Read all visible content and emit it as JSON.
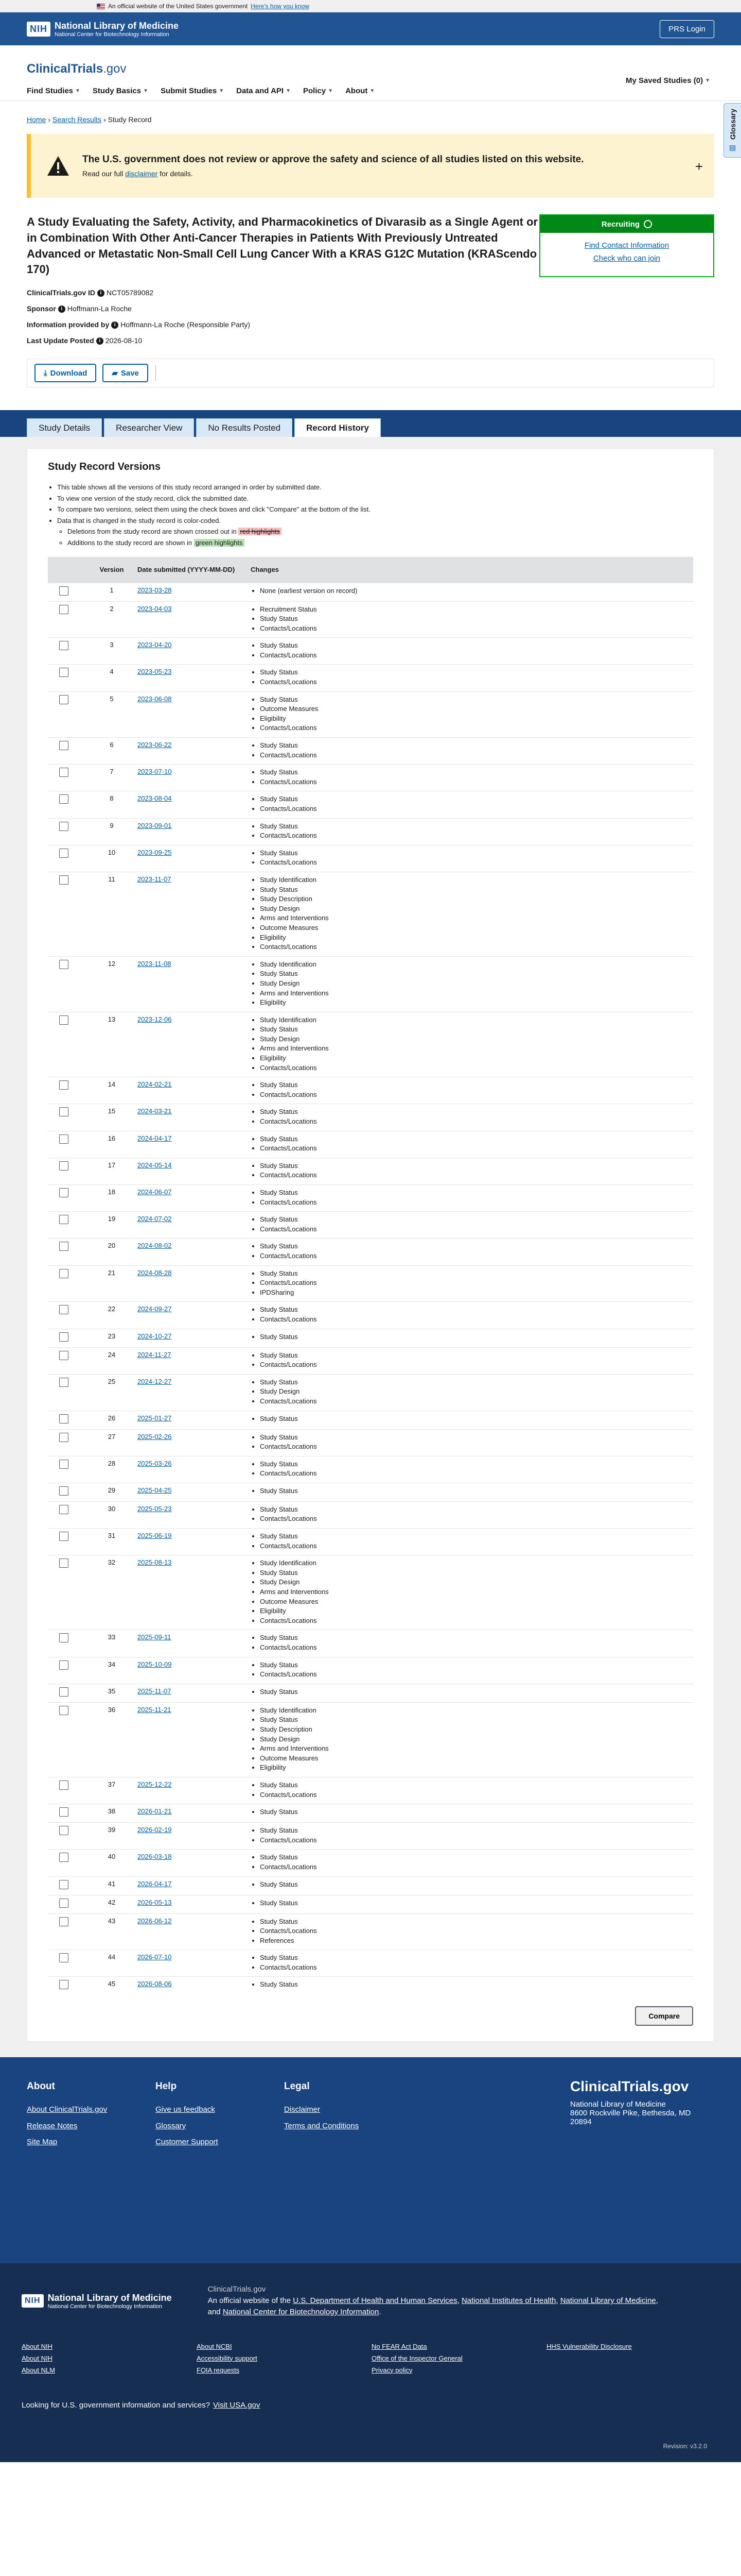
{
  "gov_banner": {
    "text": "An official website of the United States government",
    "link": "Here's how you know"
  },
  "nlm": {
    "nih": "NIH",
    "title": "National Library of Medicine",
    "subtitle": "National Center for Biotechnology Information",
    "prs_button": "PRS Login"
  },
  "header": {
    "brand": "ClinicalTrials",
    "brand_suffix": ".gov",
    "nav": [
      "Find Studies",
      "Study Basics",
      "Submit Studies",
      "Data and API",
      "Policy",
      "About"
    ],
    "saved": "My Saved Studies (0)",
    "glossary": "Glossary"
  },
  "breadcrumb": [
    "Home",
    "Search Results",
    "Study Record"
  ],
  "alert": {
    "title": "The U.S. government does not review or approve the safety and science of all studies listed on this website.",
    "body_prefix": "Read our full",
    "body_link": "disclaimer",
    "body_suffix": "for details."
  },
  "study": {
    "title": "A Study Evaluating the Safety, Activity, and Pharmacokinetics of Divarasib as a Single Agent or in Combination With Other Anti-Cancer Therapies in Patients With Previously Untreated Advanced or Metastatic Non-Small Cell Lung Cancer With a KRAS G12C Mutation (KRAScendo 170)",
    "id_label": "ClinicalTrials.gov ID",
    "id": "NCT05789082",
    "sponsor_label": "Sponsor",
    "sponsor": "Hoffmann-La Roche",
    "info_label": "Information provided by",
    "info": "Hoffmann-La Roche (Responsible Party)",
    "update_label": "Last Update Posted",
    "update": "2026-08-10"
  },
  "status_card": {
    "status": "Recruiting",
    "link1": "Find Contact Information",
    "link2": "Check who can join"
  },
  "actions": {
    "download": "Download",
    "save": "Save"
  },
  "tabs": [
    "Study Details",
    "Researcher View",
    "No Results Posted",
    "Record History"
  ],
  "versions": {
    "heading": "Study Record Versions",
    "notes": {
      "n1": "This table shows all the versions of this study record arranged in order by submitted date.",
      "n2": "To view one version of the study record, click the submitted date.",
      "n3": "To compare two versions, select them using the check boxes and click \"Compare\" at the bottom of the list.",
      "n4": "Data that is changed in the study record is color-coded.",
      "n5a": "Deletions from the study record are shown crossed out in",
      "n5b": "red highlights",
      "n6a": "Additions to the study record are shown in",
      "n6b": "green highlights"
    },
    "columns": [
      "Version",
      "Date submitted (YYYY-MM-DD)",
      "Changes"
    ],
    "rows": [
      {
        "v": "1",
        "d": "2023-03-28",
        "c": [
          "None (earliest version on record)"
        ]
      },
      {
        "v": "2",
        "d": "2023-04-03",
        "c": [
          "Recruitment Status",
          "Study Status",
          "Contacts/Locations"
        ]
      },
      {
        "v": "3",
        "d": "2023-04-20",
        "c": [
          "Study Status",
          "Contacts/Locations"
        ]
      },
      {
        "v": "4",
        "d": "2023-05-23",
        "c": [
          "Study Status",
          "Contacts/Locations"
        ]
      },
      {
        "v": "5",
        "d": "2023-06-08",
        "c": [
          "Study Status",
          "Outcome Measures",
          "Eligibility",
          "Contacts/Locations"
        ]
      },
      {
        "v": "6",
        "d": "2023-06-22",
        "c": [
          "Study Status",
          "Contacts/Locations"
        ]
      },
      {
        "v": "7",
        "d": "2023-07-10",
        "c": [
          "Study Status",
          "Contacts/Locations"
        ]
      },
      {
        "v": "8",
        "d": "2023-08-04",
        "c": [
          "Study Status",
          "Contacts/Locations"
        ]
      },
      {
        "v": "9",
        "d": "2023-09-01",
        "c": [
          "Study Status",
          "Contacts/Locations"
        ]
      },
      {
        "v": "10",
        "d": "2023-09-25",
        "c": [
          "Study Status",
          "Contacts/Locations"
        ]
      },
      {
        "v": "11",
        "d": "2023-11-07",
        "c": [
          "Study Identification",
          "Study Status",
          "Study Description",
          "Study Design",
          "Arms and Interventions",
          "Outcome Measures",
          "Eligibility",
          "Contacts/Locations"
        ]
      },
      {
        "v": "12",
        "d": "2023-11-08",
        "c": [
          "Study Identification",
          "Study Status",
          "Study Design",
          "Arms and Interventions",
          "Eligibility"
        ]
      },
      {
        "v": "13",
        "d": "2023-12-06",
        "c": [
          "Study Identification",
          "Study Status",
          "Study Design",
          "Arms and Interventions",
          "Eligibility",
          "Contacts/Locations"
        ]
      },
      {
        "v": "14",
        "d": "2024-02-21",
        "c": [
          "Study Status",
          "Contacts/Locations"
        ]
      },
      {
        "v": "15",
        "d": "2024-03-21",
        "c": [
          "Study Status",
          "Contacts/Locations"
        ]
      },
      {
        "v": "16",
        "d": "2024-04-17",
        "c": [
          "Study Status",
          "Contacts/Locations"
        ]
      },
      {
        "v": "17",
        "d": "2024-05-14",
        "c": [
          "Study Status",
          "Contacts/Locations"
        ]
      },
      {
        "v": "18",
        "d": "2024-06-07",
        "c": [
          "Study Status",
          "Contacts/Locations"
        ]
      },
      {
        "v": "19",
        "d": "2024-07-02",
        "c": [
          "Study Status",
          "Contacts/Locations"
        ]
      },
      {
        "v": "20",
        "d": "2024-08-02",
        "c": [
          "Study Status",
          "Contacts/Locations"
        ]
      },
      {
        "v": "21",
        "d": "2024-08-28",
        "c": [
          "Study Status",
          "Contacts/Locations",
          "IPDSharing"
        ]
      },
      {
        "v": "22",
        "d": "2024-09-27",
        "c": [
          "Study Status",
          "Contacts/Locations"
        ]
      },
      {
        "v": "23",
        "d": "2024-10-27",
        "c": [
          "Study Status"
        ]
      },
      {
        "v": "24",
        "d": "2024-11-27",
        "c": [
          "Study Status",
          "Contacts/Locations"
        ]
      },
      {
        "v": "25",
        "d": "2024-12-27",
        "c": [
          "Study Status",
          "Study Design",
          "Contacts/Locations"
        ]
      },
      {
        "v": "26",
        "d": "2025-01-27",
        "c": [
          "Study Status"
        ]
      },
      {
        "v": "27",
        "d": "2025-02-26",
        "c": [
          "Study Status",
          "Contacts/Locations"
        ]
      },
      {
        "v": "28",
        "d": "2025-03-26",
        "c": [
          "Study Status",
          "Contacts/Locations"
        ]
      },
      {
        "v": "29",
        "d": "2025-04-25",
        "c": [
          "Study Status"
        ]
      },
      {
        "v": "30",
        "d": "2025-05-23",
        "c": [
          "Study Status",
          "Contacts/Locations"
        ]
      },
      {
        "v": "31",
        "d": "2025-06-19",
        "c": [
          "Study Status",
          "Contacts/Locations"
        ]
      },
      {
        "v": "32",
        "d": "2025-08-13",
        "c": [
          "Study Identification",
          "Study Status",
          "Study Design",
          "Arms and Interventions",
          "Outcome Measures",
          "Eligibility",
          "Contacts/Locations"
        ]
      },
      {
        "v": "33",
        "d": "2025-09-11",
        "c": [
          "Study Status",
          "Contacts/Locations"
        ]
      },
      {
        "v": "34",
        "d": "2025-10-09",
        "c": [
          "Study Status",
          "Contacts/Locations"
        ]
      },
      {
        "v": "35",
        "d": "2025-11-07",
        "c": [
          "Study Status"
        ]
      },
      {
        "v": "36",
        "d": "2025-11-21",
        "c": [
          "Study Identification",
          "Study Status",
          "Study Description",
          "Study Design",
          "Arms and Interventions",
          "Outcome Measures",
          "Eligibility"
        ]
      },
      {
        "v": "37",
        "d": "2025-12-22",
        "c": [
          "Study Status",
          "Contacts/Locations"
        ]
      },
      {
        "v": "38",
        "d": "2026-01-21",
        "c": [
          "Study Status"
        ]
      },
      {
        "v": "39",
        "d": "2026-02-19",
        "c": [
          "Study Status",
          "Contacts/Locations"
        ]
      },
      {
        "v": "40",
        "d": "2026-03-18",
        "c": [
          "Study Status",
          "Contacts/Locations"
        ]
      },
      {
        "v": "41",
        "d": "2026-04-17",
        "c": [
          "Study Status"
        ]
      },
      {
        "v": "42",
        "d": "2026-05-13",
        "c": [
          "Study Status"
        ]
      },
      {
        "v": "43",
        "d": "2026-06-12",
        "c": [
          "Study Status",
          "Contacts/Locations",
          "References"
        ]
      },
      {
        "v": "44",
        "d": "2026-07-10",
        "c": [
          "Study Status",
          "Contacts/Locations"
        ]
      },
      {
        "v": "45",
        "d": "2026-08-06",
        "c": [
          "Study Status"
        ]
      }
    ],
    "compare": "Compare"
  },
  "footer": {
    "about_title": "About",
    "about_links": [
      "About ClinicalTrials.gov",
      "Release Notes",
      "Site Map"
    ],
    "help_title": "Help",
    "help_links": [
      "Give us feedback",
      "Glossary",
      "Customer Support"
    ],
    "legal_title": "Legal",
    "legal_links": [
      "Disclaimer",
      "Terms and Conditions"
    ],
    "org": "ClinicalTrials.gov",
    "addr1": "National Library of Medicine",
    "addr2": "8600 Rockville Pike, Bethesda, MD",
    "addr3": "20894"
  },
  "footer2": {
    "nih": "NIH",
    "nlm_title": "National Library of Medicine",
    "nlm_sub": "National Center for Biotechnology Information",
    "gov_title": "ClinicalTrials.gov",
    "gov_prefix": "An official website of the",
    "hhs": "U.S. Department of Health and Human Services",
    "nih_link": "National Institutes of Health",
    "nlm_link": "National Library of Medicine",
    "and": "and",
    "ncbi": "National Center for Biotechnology Information",
    "links": [
      "About NIH",
      "About NCBI",
      "No FEAR Act Data",
      "HHS Vulnerability Disclosure",
      "About NIH",
      "Accessibility support",
      "Office of the Inspector General",
      "About NLM",
      "FOIA requests",
      "Privacy policy"
    ],
    "bottom_text": "Looking for U.S. government information and services?",
    "bottom_link": "Visit USA.gov",
    "revision": "Revision: v3.2.0"
  }
}
